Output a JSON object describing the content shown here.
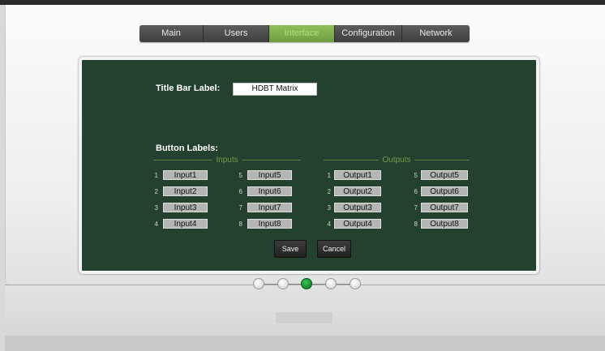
{
  "nav": {
    "tabs": [
      {
        "label": "Main"
      },
      {
        "label": "Users"
      },
      {
        "label": "Interface"
      },
      {
        "label": "Configuration"
      },
      {
        "label": "Network"
      }
    ],
    "active": "Interface"
  },
  "interface": {
    "title_bar_label": "Title Bar Label:",
    "title_bar_value": "HDBT Matrix",
    "button_labels_heading": "Button Labels:",
    "inputs_heading": "Inputs",
    "outputs_heading": "Outputs",
    "inputs": [
      {
        "num": "1",
        "value": "Input1"
      },
      {
        "num": "2",
        "value": "Input2"
      },
      {
        "num": "3",
        "value": "Input3"
      },
      {
        "num": "4",
        "value": "Input4"
      },
      {
        "num": "5",
        "value": "Input5"
      },
      {
        "num": "6",
        "value": "Input6"
      },
      {
        "num": "7",
        "value": "Input7"
      },
      {
        "num": "8",
        "value": "Input8"
      }
    ],
    "outputs": [
      {
        "num": "1",
        "value": "Output1"
      },
      {
        "num": "2",
        "value": "Output2"
      },
      {
        "num": "3",
        "value": "Output3"
      },
      {
        "num": "4",
        "value": "Output4"
      },
      {
        "num": "5",
        "value": "Output5"
      },
      {
        "num": "6",
        "value": "Output6"
      },
      {
        "num": "7",
        "value": "Output7"
      },
      {
        "num": "8",
        "value": "Output8"
      }
    ],
    "save_label": "Save",
    "cancel_label": "Cancel"
  },
  "pager": {
    "count": 5,
    "active_index": 2
  },
  "colors": {
    "panel": "#24412f",
    "active_tab": "#7aab48",
    "active_dot": "#138a2c"
  }
}
